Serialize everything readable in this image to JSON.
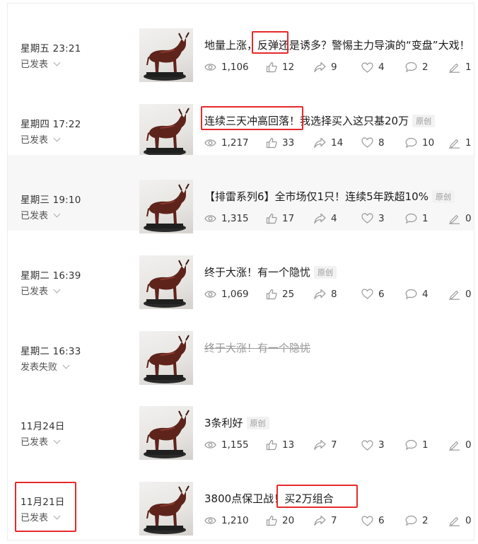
{
  "articles": [
    {
      "date": "星期五 23:21",
      "status": "已发表",
      "title_plain": "地量上涨，",
      "title_box": "反弹",
      "title_rest": "还是诱多？警惕主力导演的“变盘”大戏！",
      "badge": "",
      "strike": false,
      "stats": {
        "views": "1,106",
        "likes": "12",
        "shares": "9",
        "wows": "4",
        "comments": "2",
        "edits": "1"
      }
    },
    {
      "date": "星期四 17:22",
      "status": "已发表",
      "title_plain": "",
      "title_box": "连续三天冲高回落！",
      "title_rest": "我选择买入这只基20万",
      "badge": "原创",
      "strike": false,
      "stats": {
        "views": "1,217",
        "likes": "33",
        "shares": "14",
        "wows": "8",
        "comments": "10",
        "edits": "1"
      }
    },
    {
      "date": "星期三 19:10",
      "status": "已发表",
      "title_plain": "【排雷系列6】全市场仅1只！连续5年跌超10%",
      "title_box": "",
      "title_rest": "",
      "badge": "原创",
      "strike": false,
      "stats": {
        "views": "1,315",
        "likes": "17",
        "shares": "4",
        "wows": "3",
        "comments": "1",
        "edits": "0"
      }
    },
    {
      "date": "星期二 16:39",
      "status": "已发表",
      "title_plain": "终于大涨！有一个隐忧",
      "title_box": "",
      "title_rest": "",
      "badge": "原创",
      "strike": false,
      "stats": {
        "views": "1,069",
        "likes": "25",
        "shares": "8",
        "wows": "6",
        "comments": "4",
        "edits": "0"
      }
    },
    {
      "date": "星期二 16:33",
      "status": "发表失败",
      "title_plain": "终于大涨！有一个隐忧",
      "title_box": "",
      "title_rest": "",
      "badge": "",
      "strike": true,
      "stats": null
    },
    {
      "date": "11月24日",
      "status": "已发表",
      "title_plain": "3条利好",
      "title_box": "",
      "title_rest": "",
      "badge": "原创",
      "strike": false,
      "stats": {
        "views": "1,155",
        "likes": "13",
        "shares": "7",
        "wows": "3",
        "comments": "1",
        "edits": "0"
      }
    },
    {
      "date": "11月21日",
      "status": "已发表",
      "title_plain": "3800点保卫战！",
      "title_box": "买2万组合",
      "title_rest": "",
      "badge": "",
      "strike": false,
      "stats": {
        "views": "1,210",
        "likes": "20",
        "shares": "7",
        "wows": "6",
        "comments": "2",
        "edits": "0"
      }
    }
  ],
  "highlight_color": "#e52a2a",
  "icons": [
    "eye-icon",
    "thumb-up-icon",
    "share-icon",
    "heart-icon",
    "comment-icon",
    "pen-icon"
  ]
}
